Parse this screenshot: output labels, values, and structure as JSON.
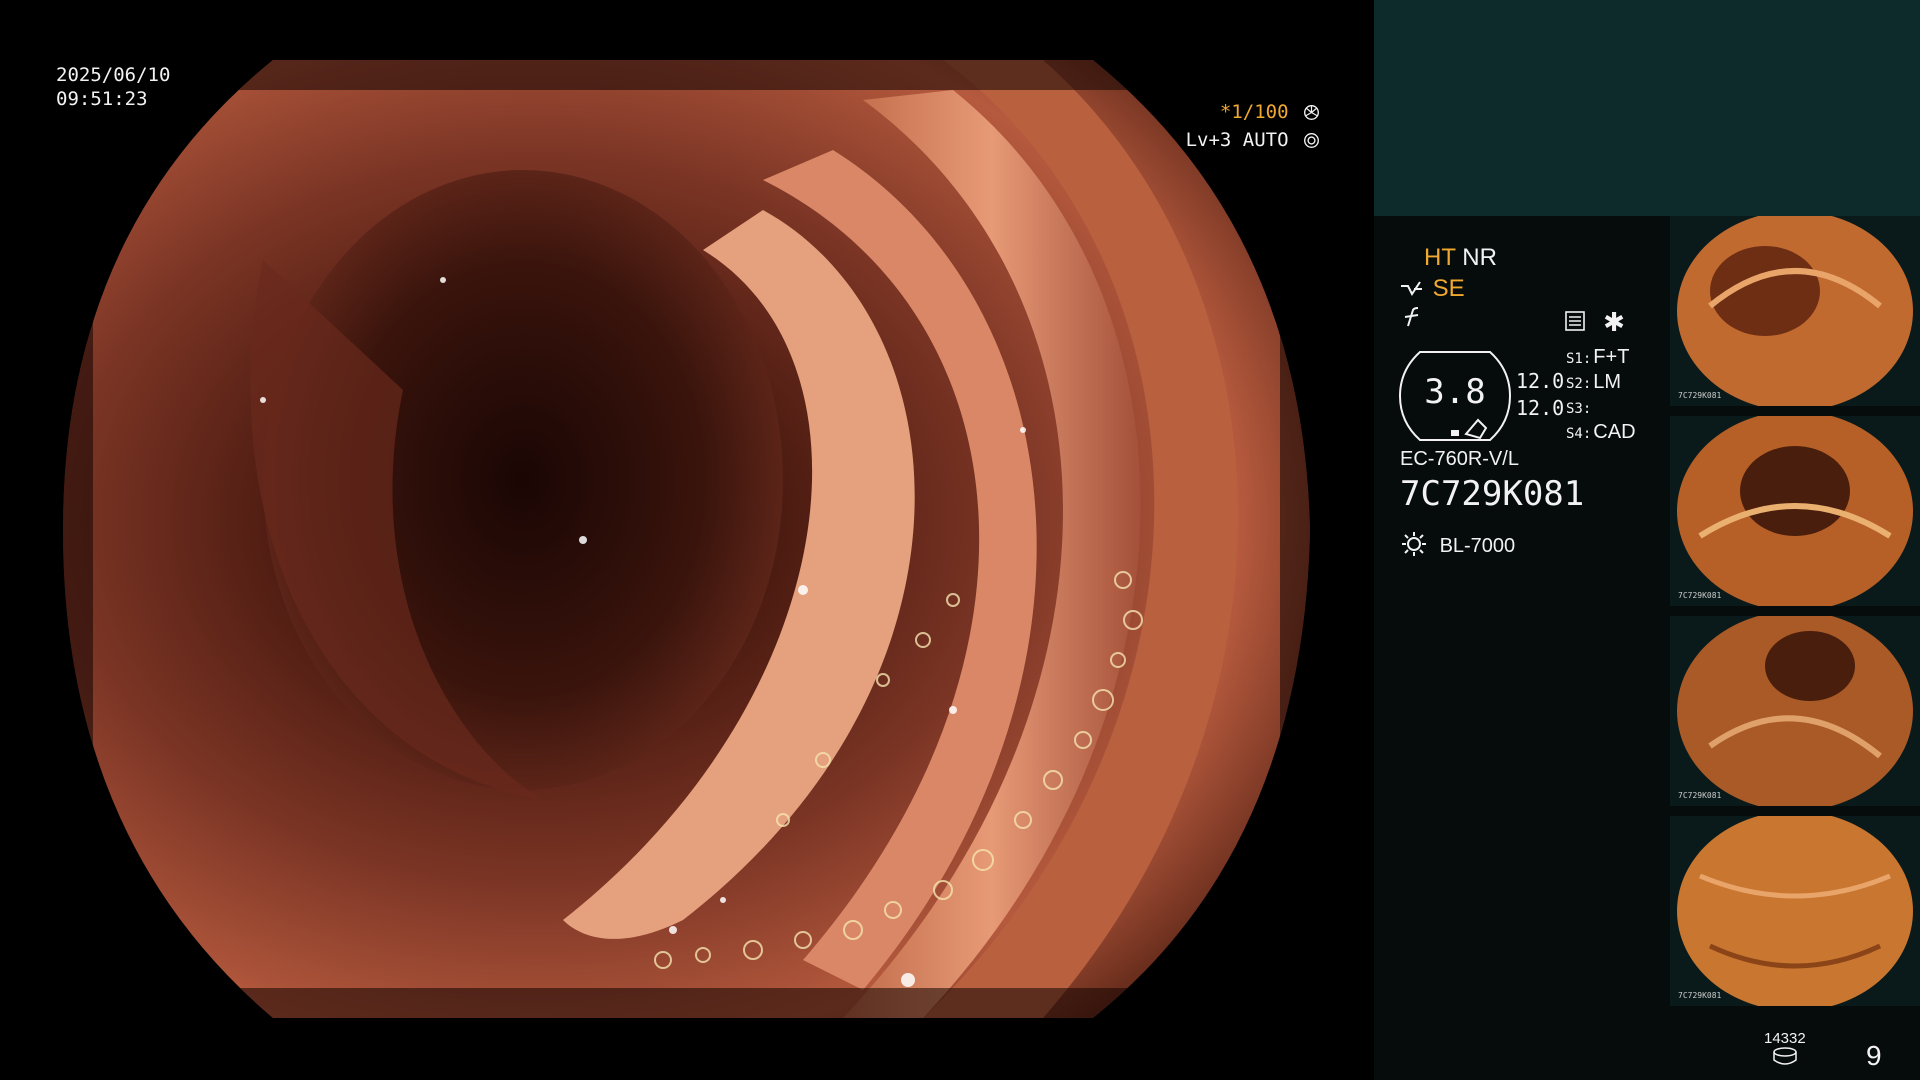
{
  "datetime": {
    "date": "2025/06/10",
    "time": "09:51:23"
  },
  "image_settings": {
    "shutter": "*1/100",
    "level": "Lv+3 AUTO"
  },
  "modes": {
    "ht": "HT",
    "nr": "NR",
    "se": "SE"
  },
  "gauge": {
    "value": "3.8",
    "upper": "12.0",
    "lower": "12.0"
  },
  "switch_assignments": [
    {
      "key": "S1:",
      "value": "F+T"
    },
    {
      "key": "S2:",
      "value": "LM"
    },
    {
      "key": "S3:",
      "value": ""
    },
    {
      "key": "S4:",
      "value": "CAD"
    }
  ],
  "scope": {
    "model": "EC-760R-V/L",
    "serial": "7C729K081"
  },
  "light_source": {
    "model": "BL-7000"
  },
  "thumbnails": [
    {
      "label": "7C729K081"
    },
    {
      "label": "7C729K081"
    },
    {
      "label": "7C729K081"
    },
    {
      "label": "7C729K081"
    }
  ],
  "storage": {
    "count": "14332",
    "frame": "9"
  },
  "colors": {
    "accent": "#f0a830",
    "panel_top": "#0e2b2c",
    "panel_body": "#060c0c"
  }
}
